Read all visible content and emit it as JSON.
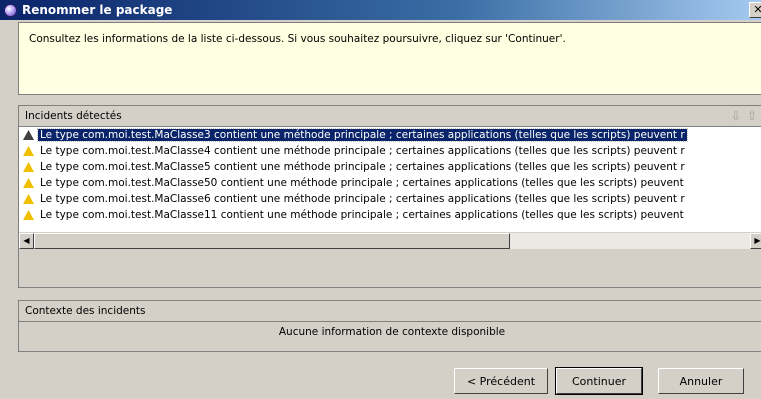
{
  "window": {
    "title": "Renommer le package",
    "close_glyph": "✕"
  },
  "info": {
    "text": "Consultez les informations de la liste ci-dessous. Si vous souhaitez poursuivre, cliquez sur 'Continuer'."
  },
  "incidents": {
    "header": "Incidents détectés",
    "down_arrow": "⇩",
    "up_arrow": "⇧",
    "rows": [
      {
        "text": "Le type com.moi.test.MaClasse3 contient une méthode principale ; certaines applications (telles que les scripts) peuvent r",
        "selected": true
      },
      {
        "text": "Le type com.moi.test.MaClasse4 contient une méthode principale ; certaines applications (telles que les scripts) peuvent r",
        "selected": false
      },
      {
        "text": "Le type com.moi.test.MaClasse5 contient une méthode principale ; certaines applications (telles que les scripts) peuvent r",
        "selected": false
      },
      {
        "text": "Le type com.moi.test.MaClasse50 contient une méthode principale ; certaines applications (telles que les scripts) peuvent",
        "selected": false
      },
      {
        "text": "Le type com.moi.test.MaClasse6 contient une méthode principale ; certaines applications (telles que les scripts) peuvent r",
        "selected": false
      },
      {
        "text": "Le type com.moi.test.MaClasse11 contient une méthode principale ; certaines applications (telles que les scripts) peuvent",
        "selected": false
      }
    ],
    "scroll_left": "◀",
    "scroll_right": "▶"
  },
  "context": {
    "header": "Contexte des incidents",
    "message": "Aucune information de contexte disponible"
  },
  "buttons": {
    "back": "< Précédent",
    "continue": "Continuer",
    "cancel": "Annuler"
  },
  "icons": {
    "app": "eclipse-icon",
    "row": "warning-icon"
  }
}
